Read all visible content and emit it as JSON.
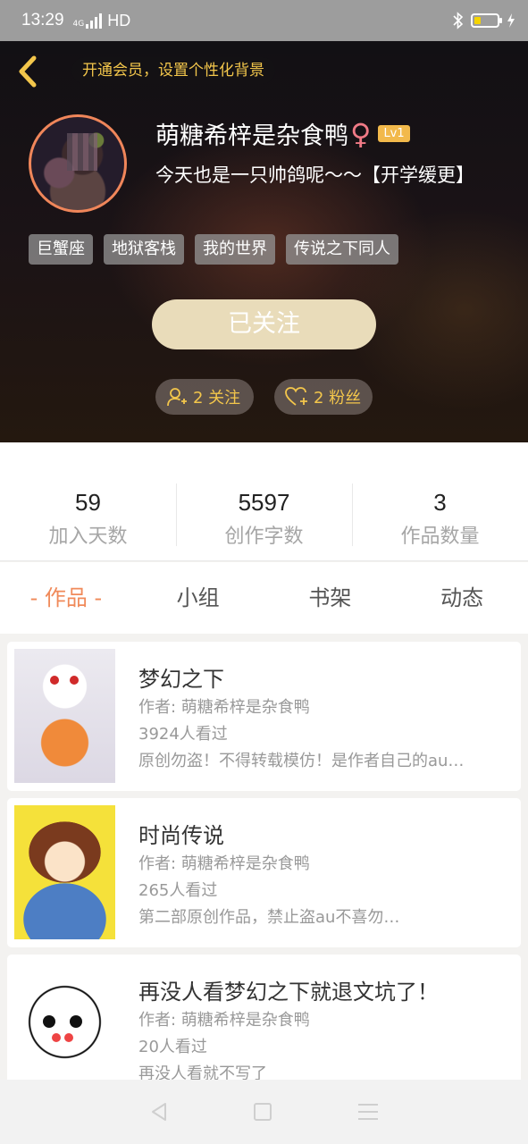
{
  "status_bar": {
    "time": "13:29",
    "network": "4G",
    "hd": "HD"
  },
  "header": {
    "bg_button_label": "开通会员，设置个性化背景",
    "nickname": "萌糖希梓是杂食鸭",
    "gender_symbol": "♀",
    "level": "Lv1",
    "signature": "今天也是一只帅鸽呢～～【开学缓更】",
    "tags": [
      "巨蟹座",
      "地狱客栈",
      "我的世界",
      "传说之下同人"
    ],
    "follow_button": "已关注",
    "following": "2 关注",
    "fans": "2 粉丝"
  },
  "stats": [
    {
      "value": "59",
      "label": "加入天数"
    },
    {
      "value": "5597",
      "label": "创作字数"
    },
    {
      "value": "3",
      "label": "作品数量"
    }
  ],
  "tabs": [
    {
      "label": "- 作品 -",
      "active": true
    },
    {
      "label": "小组",
      "active": false
    },
    {
      "label": "书架",
      "active": false
    },
    {
      "label": "动态",
      "active": false
    }
  ],
  "works": [
    {
      "title": "梦幻之下",
      "author": "作者: 萌糖希梓是杂食鸭",
      "views": "3924人看过",
      "desc": "原创勿盗！不得转载模仿！是作者自己的au…"
    },
    {
      "title": "时尚传说",
      "author": "作者: 萌糖希梓是杂食鸭",
      "views": "265人看过",
      "desc": "第二部原创作品，禁止盗au不喜勿…"
    },
    {
      "title": "再没人看梦幻之下就退文坑了！",
      "author": "作者: 萌糖希梓是杂食鸭",
      "views": "20人看过",
      "desc": "再没人看就不写了"
    }
  ],
  "colors": {
    "accent": "#f08a5a",
    "gold": "#f3c64b",
    "follow_button": "#e9dcba",
    "avatar_border": "#f0865a"
  },
  "icons": [
    "back-chevron-icon",
    "bluetooth-icon",
    "battery-icon",
    "follow-user-icon",
    "heart-plus-icon",
    "nav-back-icon",
    "nav-home-icon",
    "nav-menu-icon"
  ]
}
